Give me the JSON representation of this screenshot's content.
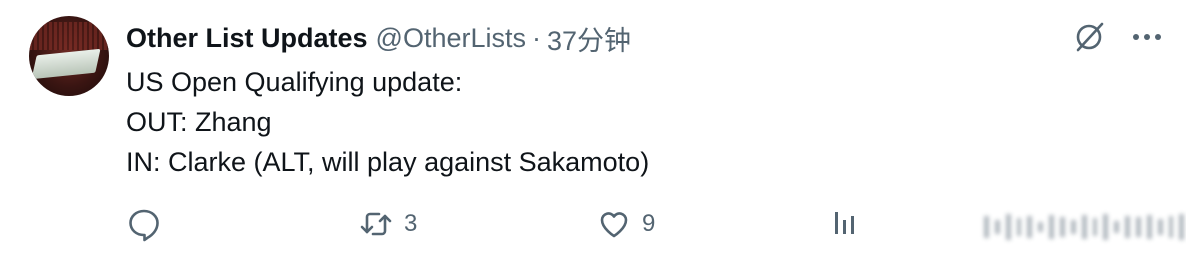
{
  "author": {
    "display_name": "Other List Updates",
    "handle": "@OtherLists",
    "separator": "·",
    "time_ago": "37分钟"
  },
  "tweet": {
    "lines": [
      "US Open Qualifying update:",
      "OUT: Zhang",
      "IN: Clarke (ALT, will play against Sakamoto)"
    ]
  },
  "top_icons": [
    "grok-slash-icon",
    "more-dots-icon"
  ],
  "actions": {
    "reply_count": "",
    "retweet_count": "3",
    "like_count": "9",
    "views_count": ""
  },
  "colors": {
    "text": "#0f1419",
    "secondary": "#536471",
    "background": "#ffffff"
  }
}
